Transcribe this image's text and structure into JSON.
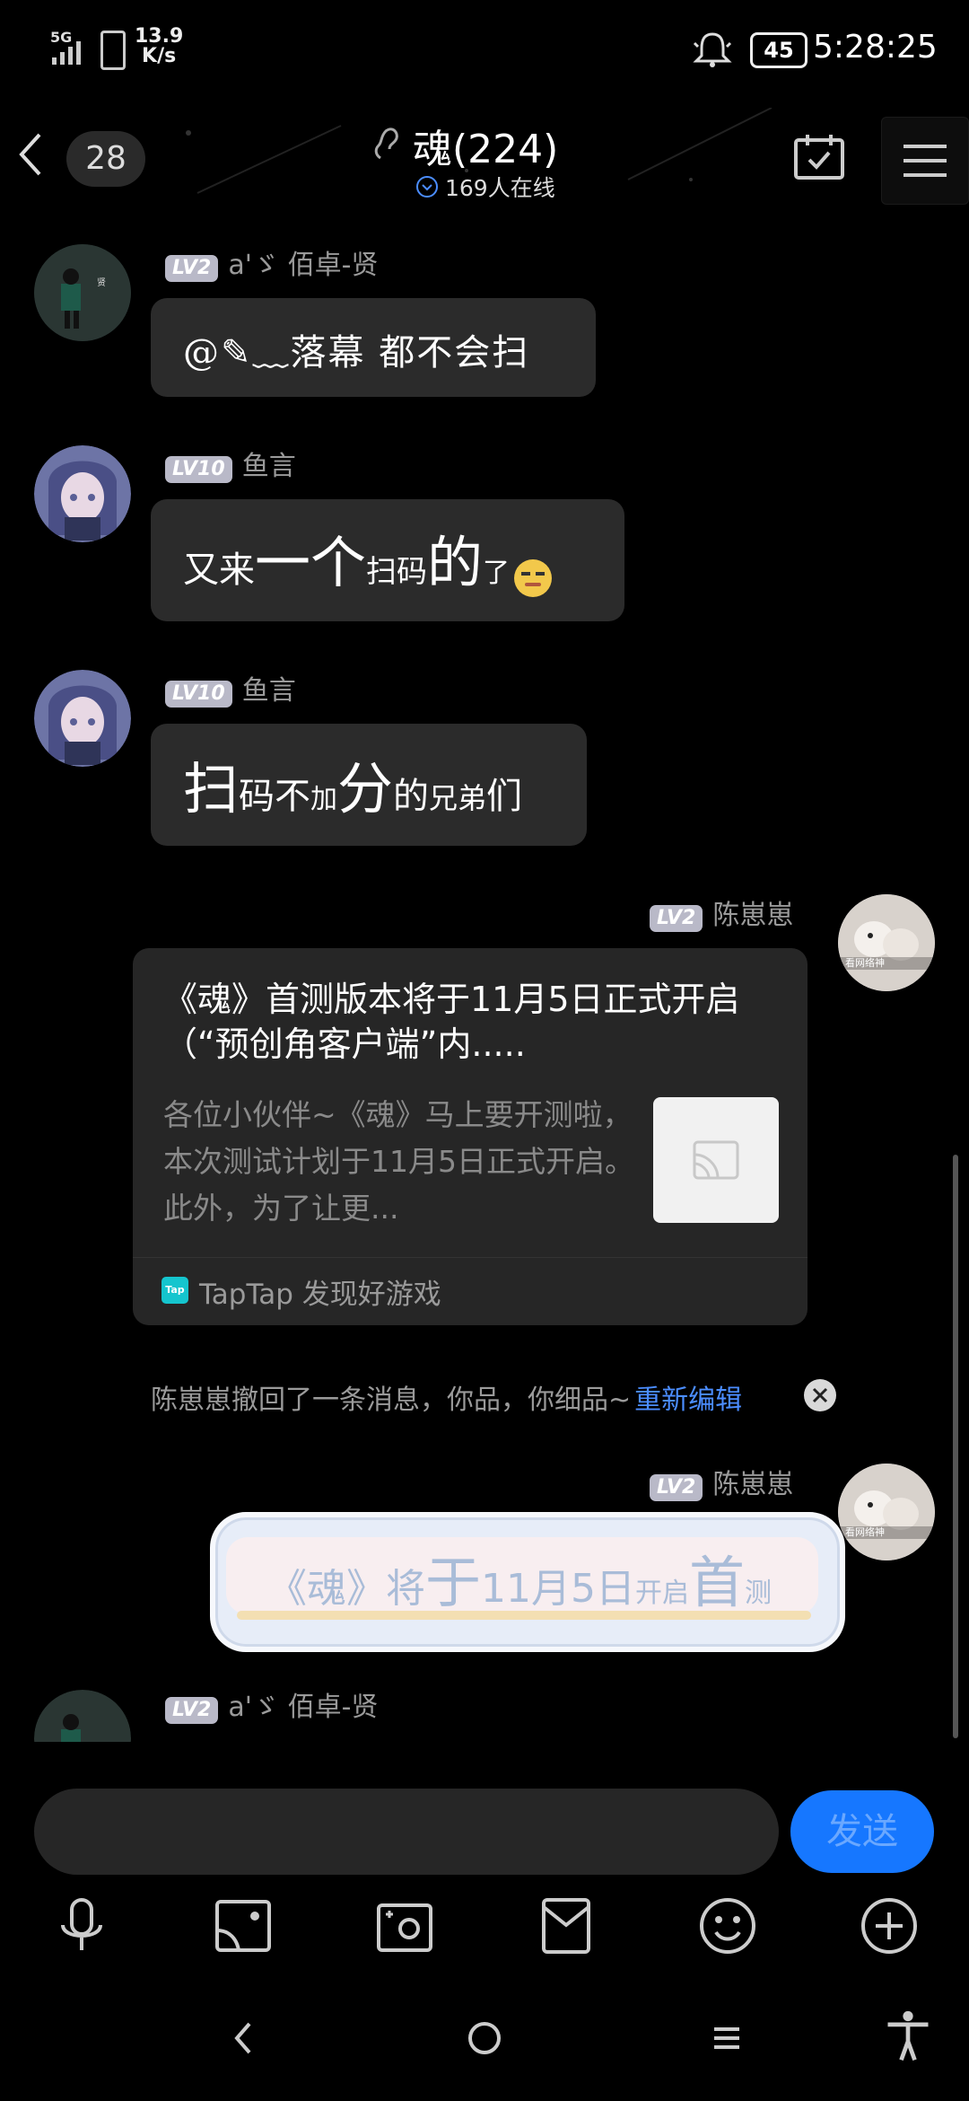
{
  "status_bar": {
    "signal": "5G",
    "speed_value": "13.9",
    "speed_unit": "K/s",
    "battery": "45",
    "time": "5:28:25"
  },
  "header": {
    "unread_count": "28",
    "title": "魂(224)",
    "online": "169人在线"
  },
  "messages": [
    {
      "level": "LV2",
      "name": "a'ゞ 佰卓-贤",
      "text": "@✎﹏落幕 都不会扫"
    },
    {
      "level": "LV10",
      "name": "鱼言",
      "text_parts": [
        "又来",
        "一个",
        "扫码",
        "的",
        "了"
      ]
    },
    {
      "level": "LV10",
      "name": "鱼言",
      "text_parts": [
        "扫",
        "码不",
        "加",
        "分",
        "的",
        "兄弟",
        "们"
      ]
    },
    {
      "level": "LV2",
      "name": "陈崽崽",
      "card": {
        "title": "《魂》首测版本将于11月5日正式开启（“预创角客户端”内.....",
        "desc": "各位小伙伴~《魂》马上要开测啦，本次测试计划于11月5日正式开启。此外，为了让更...",
        "source_logo": "Tap",
        "source": "TapTap 发现好游戏"
      }
    },
    {
      "system": true,
      "text": "陈崽崽撤回了一条消息，你品，你细品~",
      "link": "重新编辑"
    },
    {
      "level": "LV2",
      "name": "陈崽崽",
      "sticker_parts": [
        "《魂》将",
        "于",
        "11月5日",
        "开启",
        "首",
        "测"
      ]
    },
    {
      "level": "LV2",
      "name": "a'ゞ 佰卓-贤"
    }
  ],
  "input": {
    "placeholder": "",
    "send_label": "发送"
  },
  "colors": {
    "accent": "#1677ff",
    "link": "#4b8dff",
    "bubble": "#2b2b2b"
  },
  "icons": {
    "toolbar": [
      "mic-icon",
      "image-icon",
      "camera-icon",
      "red-packet-icon",
      "emoji-icon",
      "plus-icon"
    ],
    "nav": [
      "back-nav-icon",
      "home-nav-icon",
      "menu-nav-icon",
      "accessibility-icon"
    ]
  }
}
